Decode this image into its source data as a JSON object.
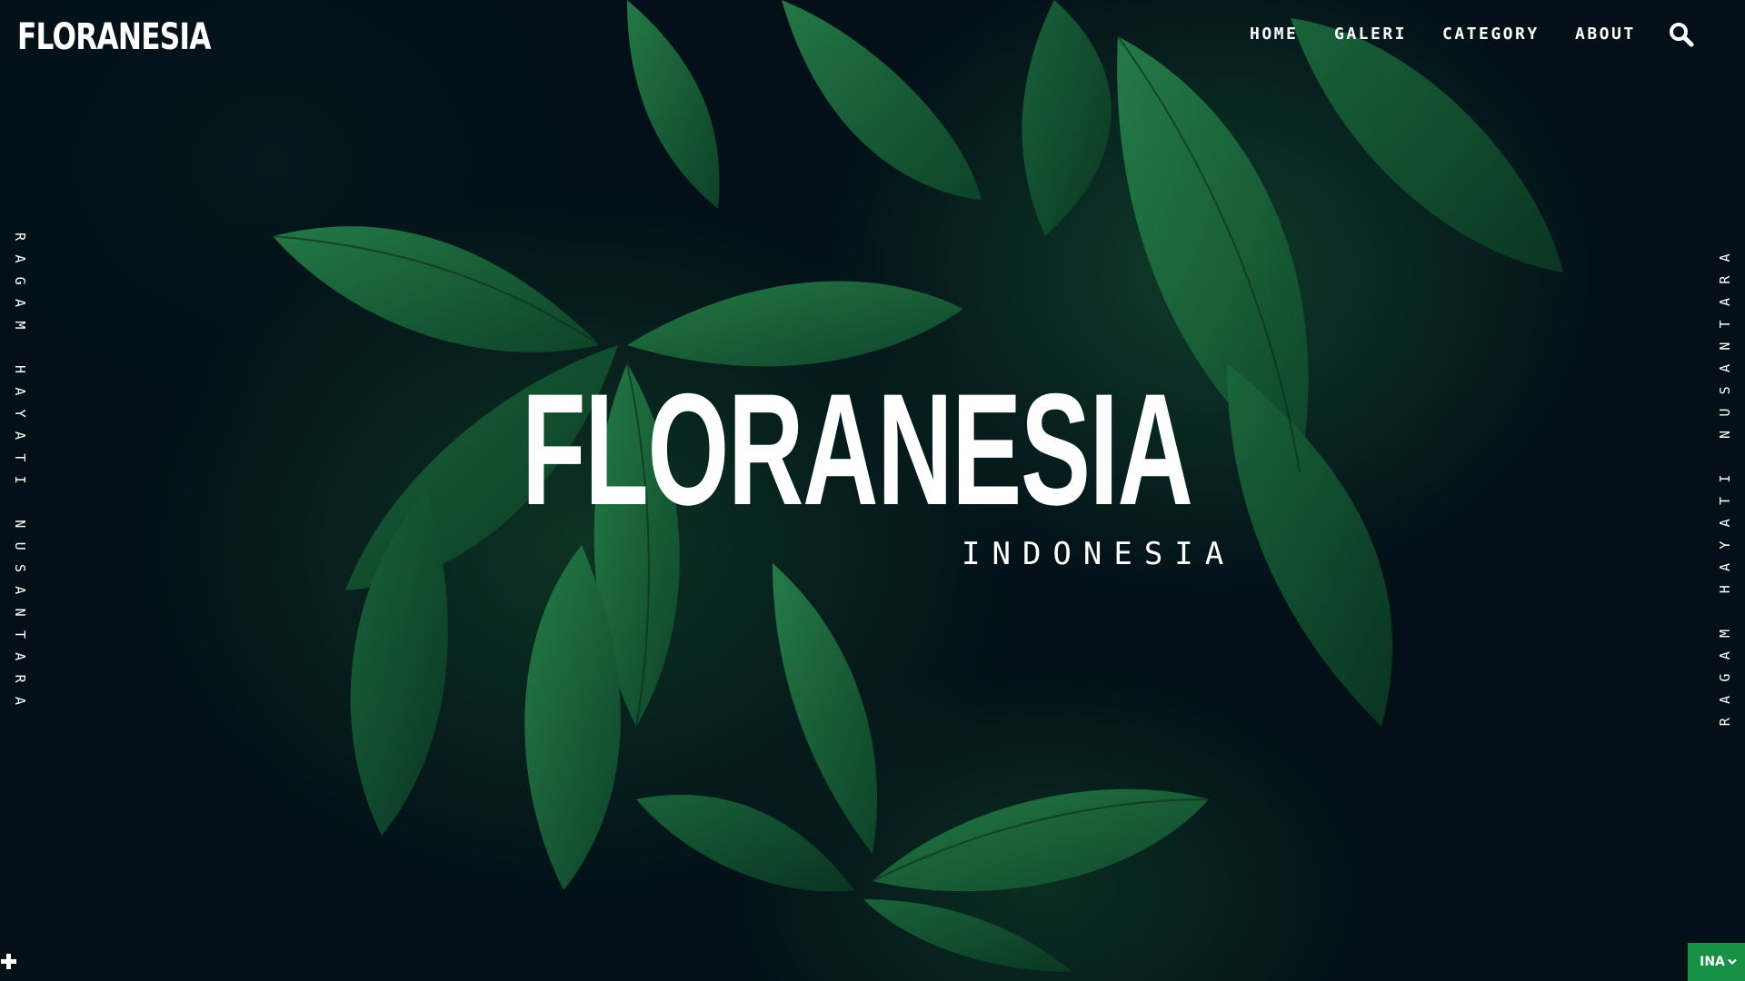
{
  "header": {
    "logo_text": "FLORANESIA",
    "nav": [
      {
        "label": "HOME"
      },
      {
        "label": "GALERI"
      },
      {
        "label": "CATEGORY"
      },
      {
        "label": "ABOUT"
      }
    ],
    "search_icon": "search-icon"
  },
  "hero": {
    "title": "FLORANESIA",
    "subtitle": "INDONESIA",
    "background": "dark green leaves photograph"
  },
  "side": {
    "left_text": "RAGAM HAYATI NUSANTARA",
    "right_text": "RAGAM HAYATI NUSANTARA"
  },
  "footer": {
    "plus_icon": "plus-icon",
    "language": "INA",
    "language_chevron_icon": "chevron-down-icon"
  },
  "colors": {
    "accent": "#179146",
    "text": "#ffffff",
    "background": "#031018",
    "leaf_green": "#1f7a45"
  }
}
